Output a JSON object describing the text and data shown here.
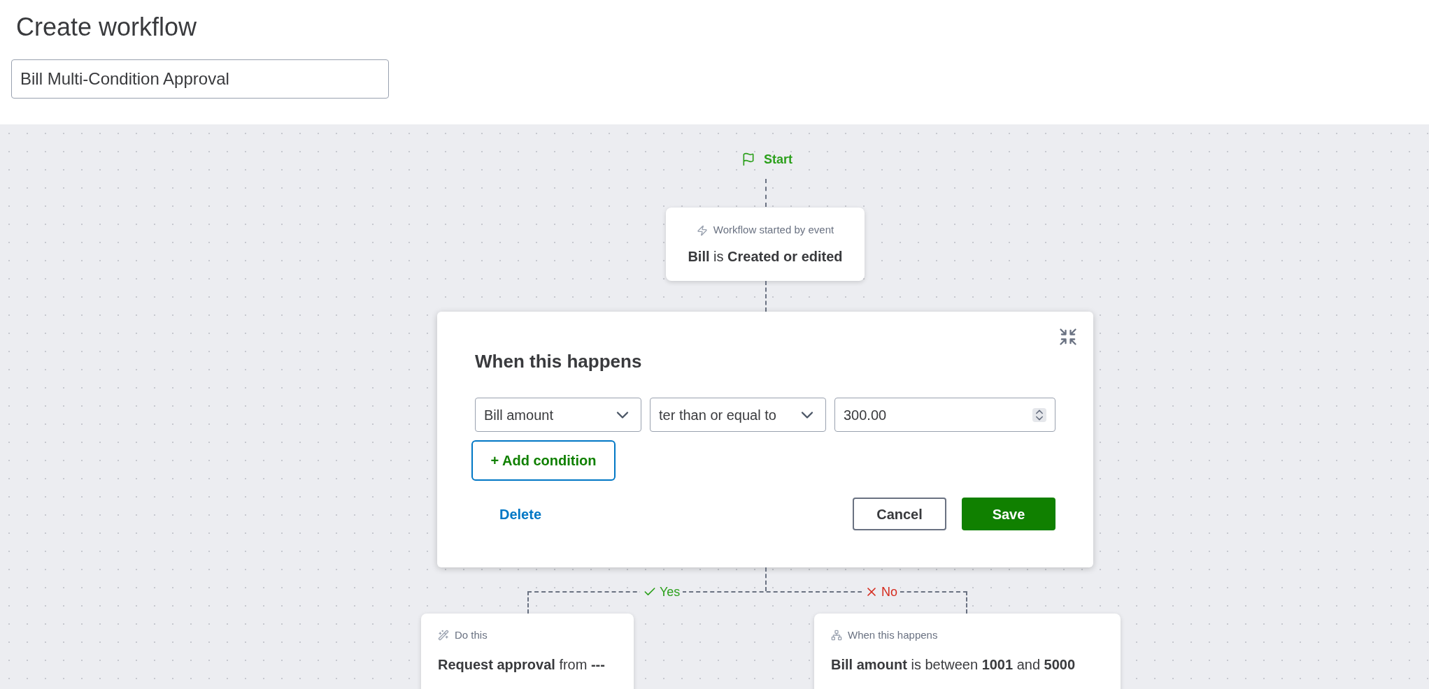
{
  "page": {
    "title": "Create workflow"
  },
  "workflow_name": {
    "value": "Bill Multi-Condition Approval"
  },
  "start": {
    "label": "Start"
  },
  "trigger": {
    "caption": "Workflow started by event",
    "text": "**Bill** is **Created or edited**"
  },
  "condition_editor": {
    "title": "When this happens",
    "fields": [
      {
        "kind": "select",
        "value": "Bill amount"
      },
      {
        "kind": "select",
        "value": "ter than or equal to"
      },
      {
        "kind": "number",
        "value": "300.00"
      }
    ],
    "add_condition": "+ Add condition",
    "delete": "Delete",
    "cancel": "Cancel",
    "save": "Save"
  },
  "branches": [
    {
      "kind": "yes",
      "label": "Yes",
      "card": {
        "kind": "action",
        "caption": "Do this",
        "text": "**Request approval** from **---**"
      }
    },
    {
      "kind": "no",
      "label": "No",
      "card": {
        "kind": "condition",
        "caption": "When this happens",
        "text": "**Bill amount** is between **1001** and **5000**"
      }
    }
  ]
}
